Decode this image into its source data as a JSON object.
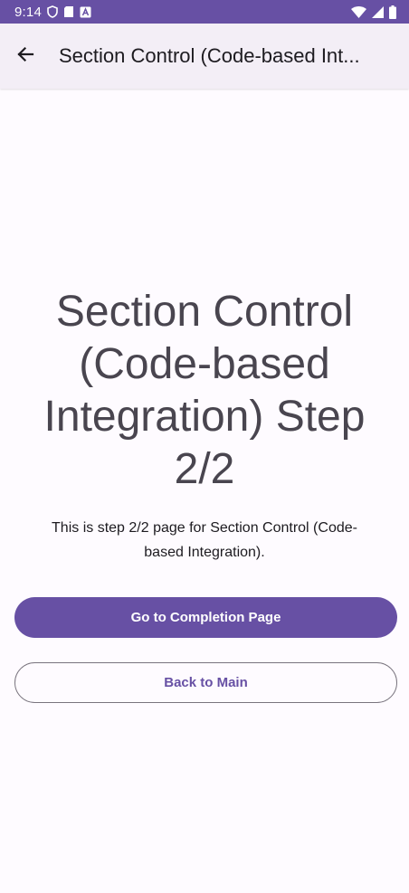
{
  "status_bar": {
    "time": "9:14",
    "icons": [
      "shield-icon",
      "sd-card-icon",
      "font-a-icon",
      "wifi-icon",
      "signal-icon",
      "battery-icon"
    ]
  },
  "app_bar": {
    "back_icon": "arrow-back-icon",
    "title": "Section Control (Code-based Int..."
  },
  "main": {
    "heading": "Section Control (Code-based Integration) Step 2/2",
    "description": "This is step 2/2 page for Section Control (Code-based Integration).",
    "primary_button": "Go to Completion Page",
    "secondary_button": "Back to Main"
  },
  "colors": {
    "primary": "#6750a4",
    "app_bar_bg": "#f3eef6",
    "background": "#fefbff",
    "heading_text": "#49454f",
    "outline": "#79747e"
  }
}
